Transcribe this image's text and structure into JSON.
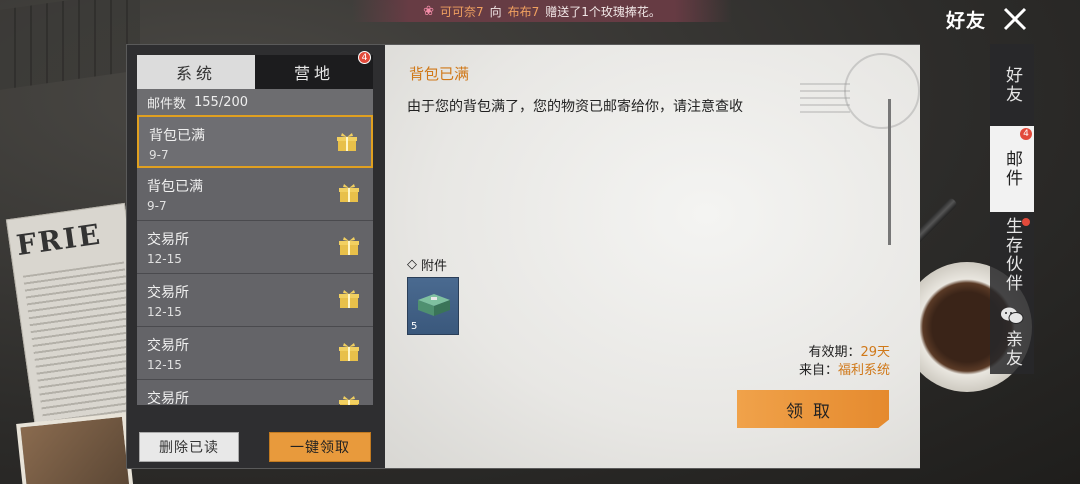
{
  "notice": {
    "sender": "可可奈7",
    "mid1": "向",
    "receiver": "布布7",
    "action": "赠送了1个玫瑰捧花。"
  },
  "header": {
    "title": "好友"
  },
  "right_tabs": [
    {
      "label": "好友"
    },
    {
      "label": "邮件",
      "badge": "4"
    },
    {
      "label": "生存伙伴"
    },
    {
      "label": "亲友"
    }
  ],
  "tabs": {
    "system": "系统",
    "camp": "营地",
    "camp_badge": "4"
  },
  "mail_count": {
    "label": "邮件数",
    "value": "155/200"
  },
  "mails": [
    {
      "title": "背包已满",
      "date": "9-7"
    },
    {
      "title": "背包已满",
      "date": "9-7"
    },
    {
      "title": "交易所",
      "date": "12-15"
    },
    {
      "title": "交易所",
      "date": "12-15"
    },
    {
      "title": "交易所",
      "date": "12-15"
    },
    {
      "title": "交易所",
      "date": ""
    }
  ],
  "buttons": {
    "delete_read": "删除已读",
    "claim_all": "一键领取",
    "claim": "领取"
  },
  "content": {
    "title": "背包已满",
    "body": "由于您的背包满了，您的物资已邮寄给你，请注意查收",
    "attach_label": "附件",
    "attachment_qty": "5",
    "validity_label": "有效期：",
    "validity_value": "29天",
    "from_label": "来自：",
    "from_value": "福利系统"
  },
  "colors": {
    "accent": "#e89a3c",
    "highlight_text": "#d07818",
    "badge": "#e24a3b"
  },
  "icons": [
    "close-icon",
    "gift-icon",
    "wechat-icon",
    "supply-box-icon",
    "flower-icon"
  ]
}
